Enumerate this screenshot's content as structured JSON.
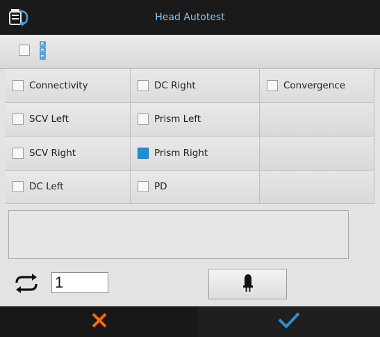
{
  "window": {
    "title": "Head Autotest"
  },
  "select_all": {
    "checked": false
  },
  "tests": [
    {
      "label": "Connectivity",
      "checked": false
    },
    {
      "label": "DC Right",
      "checked": false
    },
    {
      "label": "Convergence",
      "checked": false
    },
    {
      "label": "SCV Left",
      "checked": false
    },
    {
      "label": "Prism Left",
      "checked": false
    },
    {
      "label": "SCV Right",
      "checked": false
    },
    {
      "label": "Prism Right",
      "checked": true
    },
    {
      "label": "DC Left",
      "checked": false
    },
    {
      "label": "PD",
      "checked": false
    }
  ],
  "message": "",
  "repeat": {
    "value": "1"
  },
  "icons": {
    "title": "head-stethoscope-icon",
    "select_all": "checklist-icon",
    "repeat": "repeat-icon",
    "lamp": "lamp-icon",
    "cancel": "close-icon",
    "ok": "checkmark-icon"
  },
  "colors": {
    "accent": "#1e8ed6",
    "title_text": "#7fc7ff",
    "cancel": "#ff6a00",
    "ok": "#2a8fd6"
  }
}
